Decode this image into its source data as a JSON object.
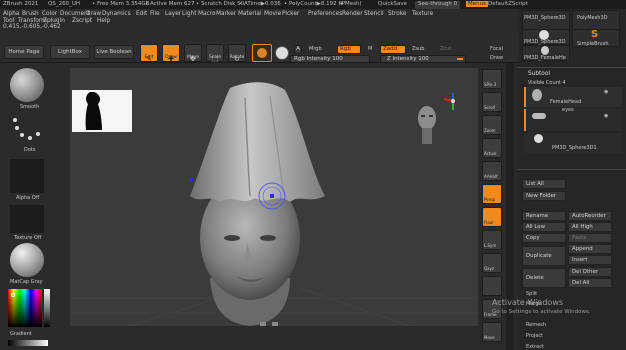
{
  "titlebar": {
    "app": "ZBrush 2021",
    "project": "QS_260_UH",
    "free_mem": "• Free Mem 3.354GB",
    "active_mem": "• Active Mem 627",
    "scratch": "• Scratch Disk 50",
    "atime": "• ATime▶0.036",
    "polycount": "• PolyCount▶8.192 KP",
    "mesh": "• Mesh(",
    "quicksave": "QuickSave",
    "see_through": "See-through",
    "see_through_val": "0",
    "menus": "Menus",
    "default_script": "DefaultZScript"
  },
  "menu_row1": [
    "Alpha",
    "Brush",
    "Color",
    "Document",
    "Draw",
    "Dynamics",
    "Edit",
    "File",
    "Layer",
    "Light",
    "Macro",
    "Marker",
    "Material",
    "Movie",
    "Picker",
    "Preferences",
    "Render",
    "Stencil",
    "Stroke",
    "Texture"
  ],
  "menu_row2": [
    "Tool",
    "Transform",
    "Zplugin",
    "Zscript",
    "Help"
  ],
  "coords": "0.415,-0.605,-0.462",
  "toolbar": {
    "home_page": "Home Page",
    "lightbox": "LightBox",
    "live_boolean": "Live Boolean",
    "edit": "Edit",
    "draw": "Draw",
    "move": "Move",
    "scale": "Scale",
    "rotate": "Rotate",
    "a_label": "A",
    "mrgb": "Mrgb",
    "rgb": "Rgb",
    "m_label": "M",
    "zadd": "Zadd",
    "zsub": "Zsub",
    "zcut": "Zcut",
    "rgb_intensity": "Rgb Intensity 100",
    "z_intensity": "Z Intensity 100",
    "focal": "Focal",
    "draw_size": "Draw"
  },
  "left_panel": {
    "smooth": "Smooth",
    "dots": "Dots",
    "alpha_off": "Alpha Off",
    "texture_off": "Texture Off",
    "matcap": "MatCap Gray",
    "gradient": "Gradient"
  },
  "right_tools": [
    "SPix 3",
    "Scroll",
    "Zoom",
    "Actual",
    "AAHalf",
    "Persp",
    "Floor",
    "L.Sym",
    "Qxyz",
    "",
    "Frame",
    "Move"
  ],
  "right_panel": {
    "top_items": [
      "PM3D_Sphere3D",
      "PolyMesh3D",
      "PM3D_Sphere3D",
      "SimpleBrush",
      "PM3D_FemaleHe"
    ],
    "subtool_title": "Subtool",
    "visible_count": "Visible Count 4",
    "subtools": [
      "FemaleHead",
      "eyes",
      "PM3D_Sphere3D1"
    ],
    "list_all": "List All",
    "new_folder": "New Folder",
    "rename": "Rename",
    "auto_reorder": "AutoReorder",
    "all_low": "All Low",
    "all_high": "All High",
    "copy": "Copy",
    "paste": "Paste",
    "duplicate": "Duplicate",
    "append": "Append",
    "insert": "Insert",
    "delete": "Delete",
    "del_other": "Del Other",
    "del_all": "Del All",
    "split": "Split",
    "merge": "Merge",
    "remesh": "Remesh",
    "project": "Project",
    "extract": "Extract"
  },
  "watermark": {
    "line1": "Activate Windows",
    "line2": "Go to Settings to activate Windows."
  }
}
